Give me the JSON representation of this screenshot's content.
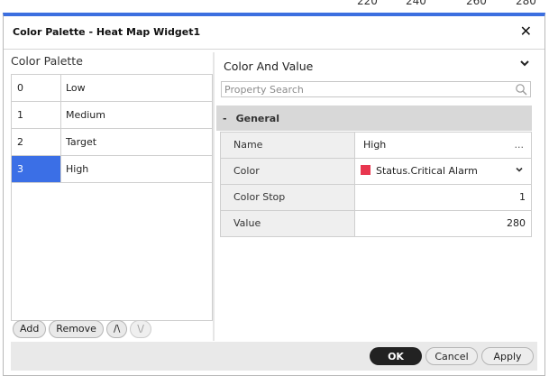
{
  "background_axis": {
    "ticks": [
      "220",
      "240",
      "260",
      "280"
    ]
  },
  "dialog": {
    "title": "Color Palette - Heat Map Widget1",
    "close_icon": "✕",
    "accent_color": "#3c6fe0"
  },
  "left_panel": {
    "heading": "Color Palette",
    "items": [
      {
        "index": "0",
        "name": "Low"
      },
      {
        "index": "1",
        "name": "Medium"
      },
      {
        "index": "2",
        "name": "Target"
      },
      {
        "index": "3",
        "name": "High"
      }
    ],
    "selected_index": 3,
    "buttons": {
      "add": "Add",
      "remove": "Remove",
      "move_up": "/\\",
      "move_down": "\\/"
    }
  },
  "right_panel": {
    "header": "Color And Value",
    "search_placeholder": "Property Search",
    "group_toggle": "-",
    "group_label": "General",
    "properties": {
      "name_label": "Name",
      "name_value": "High",
      "name_more": "...",
      "color_label": "Color",
      "color_value": "Status.Critical Alarm",
      "color_swatch": "#e8364f",
      "color_stop_label": "Color Stop",
      "color_stop_value": "1",
      "value_label": "Value",
      "value_value": "280"
    }
  },
  "footer": {
    "ok": "OK",
    "cancel": "Cancel",
    "apply": "Apply"
  }
}
